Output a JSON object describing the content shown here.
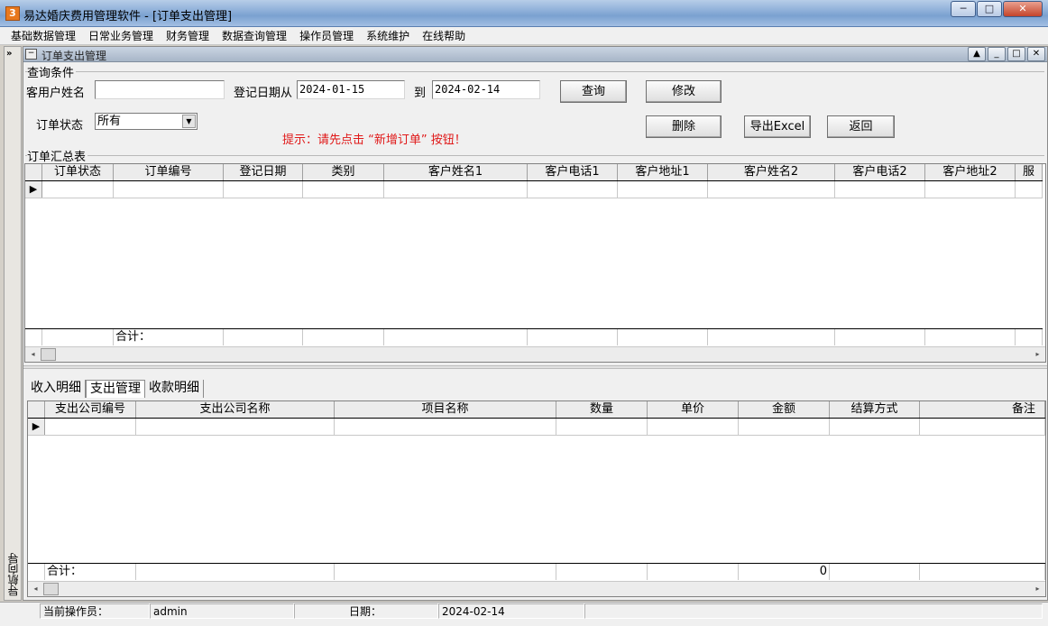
{
  "window": {
    "app_icon": "3",
    "title": "易达婚庆费用管理软件   - [订单支出管理]",
    "minimize_icon": "─",
    "maximize_icon": "□",
    "close_icon": "✕"
  },
  "menu": [
    "基础数据管理",
    "日常业务管理",
    "财务管理",
    "数据查询管理",
    "操作员管理",
    "系统维护",
    "在线帮助"
  ],
  "nav": {
    "toggle": "»",
    "label": "导航向导"
  },
  "child": {
    "title": "订单支出管理",
    "sys_icon": "−",
    "btns": [
      "▲",
      "_",
      "□",
      "✕"
    ]
  },
  "query": {
    "group_label": "查询条件",
    "customer_label": "客用户姓名",
    "customer_value": "",
    "date_from_label": "登记日期从",
    "date_from_value": "2024-01-15",
    "date_to_label": "到",
    "date_to_value": "2024-02-14",
    "status_label": "订单状态",
    "status_value": "所有",
    "status_arrow": "▼",
    "hint": "提示：请先点击 “新增订单” 按钮！",
    "buttons": {
      "query": "查询",
      "modify": "修改",
      "delete": "删除",
      "export": "导出Excel",
      "back": "返回"
    }
  },
  "summary": {
    "group_label": "订单汇总表",
    "columns": [
      "订单状态",
      "订单编号",
      "登记日期",
      "类别",
      "客户姓名1",
      "客户电话1",
      "客户地址1",
      "客户姓名2",
      "客户电话2",
      "客户地址2",
      "服"
    ],
    "row_indicator": "▶",
    "total_label": "合计：",
    "scroll_left": "◂",
    "scroll_right": "▸"
  },
  "tabs": [
    "收入明细",
    "支出管理",
    "收款明细"
  ],
  "expense": {
    "columns": [
      "支出公司编号",
      "支出公司名称",
      "项目名称",
      "数量",
      "单价",
      "金额",
      "结算方式",
      "备注"
    ],
    "row_indicator": "▶",
    "total_label": "合计：",
    "total_amount": "0",
    "scroll_left": "◂",
    "scroll_right": "▸"
  },
  "status": {
    "operator_label": "当前操作员：",
    "operator_value": "admin",
    "date_label": "日期：",
    "date_value": "2024-02-14"
  }
}
